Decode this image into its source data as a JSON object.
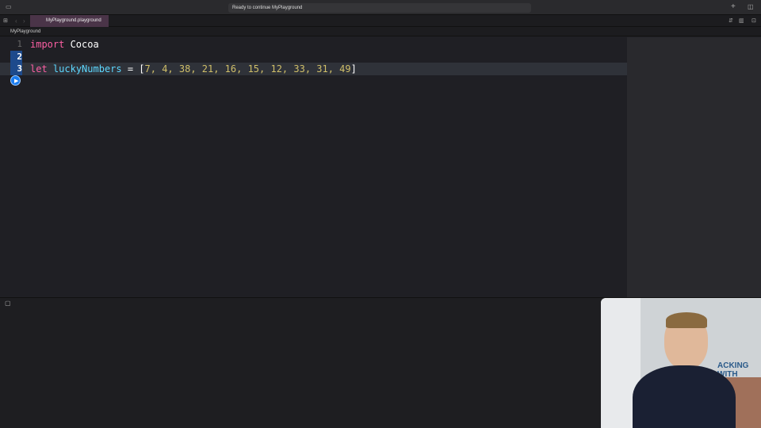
{
  "status": "Ready to continue MyPlayground",
  "tab": "MyPlayground.playground",
  "breadcrumb": "MyPlayground",
  "lines": [
    {
      "num": "1",
      "kw": "import",
      "rest": " Cocoa"
    },
    {
      "num": "2"
    },
    {
      "num": "3",
      "kw": "let",
      "ident": "luckyNumbers",
      "op": " = [",
      "values": "7, 4, 38, 21, 16, 15, 12, 33, 31, 49",
      "close": "]"
    }
  ],
  "webcam_text": "ACKING WITH"
}
